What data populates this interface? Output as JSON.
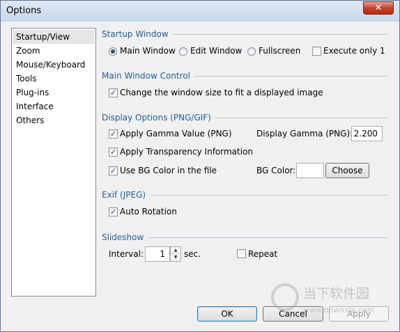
{
  "window": {
    "title": "Options",
    "close_label": "✕"
  },
  "sidebar": {
    "items": [
      {
        "label": "Startup/View",
        "selected": true
      },
      {
        "label": "Zoom"
      },
      {
        "label": "Mouse/Keyboard"
      },
      {
        "label": "Tools"
      },
      {
        "label": "Plug-ins"
      },
      {
        "label": "Interface"
      },
      {
        "label": "Others"
      }
    ]
  },
  "startup_window": {
    "heading": "Startup Window",
    "options": [
      "Main Window",
      "Edit Window",
      "Fullscreen"
    ],
    "selected": "Main Window",
    "execute_only_1_label": "Execute only 1",
    "execute_only_1_checked": false
  },
  "main_window_control": {
    "heading": "Main Window Control",
    "change_size_label": "Change the window size to fit a displayed image",
    "change_size_checked": true
  },
  "display_options": {
    "heading": "Display Options (PNG/GIF)",
    "apply_gamma_label": "Apply Gamma Value (PNG)",
    "apply_gamma_checked": true,
    "display_gamma_label": "Display Gamma (PNG):",
    "display_gamma_value": "2.200",
    "apply_transparency_label": "Apply Transparency Information",
    "apply_transparency_checked": true,
    "use_bg_color_label": "Use BG Color in the file",
    "use_bg_color_checked": true,
    "bg_color_label": "BG Color:",
    "bg_color_value": "#ffffff",
    "choose_label": "Choose"
  },
  "exif": {
    "heading": "Exif (JPEG)",
    "auto_rotation_label": "Auto Rotation",
    "auto_rotation_checked": true
  },
  "slideshow": {
    "heading": "Slideshow",
    "interval_label": "Interval:",
    "interval_value": "1",
    "sec_label": "sec.",
    "repeat_label": "Repeat",
    "repeat_checked": false
  },
  "footer": {
    "ok_label": "OK",
    "cancel_label": "Cancel",
    "apply_label": "Apply"
  },
  "watermark": {
    "text": "当下软件园",
    "url": "www.downxia.com"
  },
  "colors": {
    "heading": "#245e98",
    "group_line": "#b5c6dc",
    "titlebar": "#c7d7ea"
  }
}
